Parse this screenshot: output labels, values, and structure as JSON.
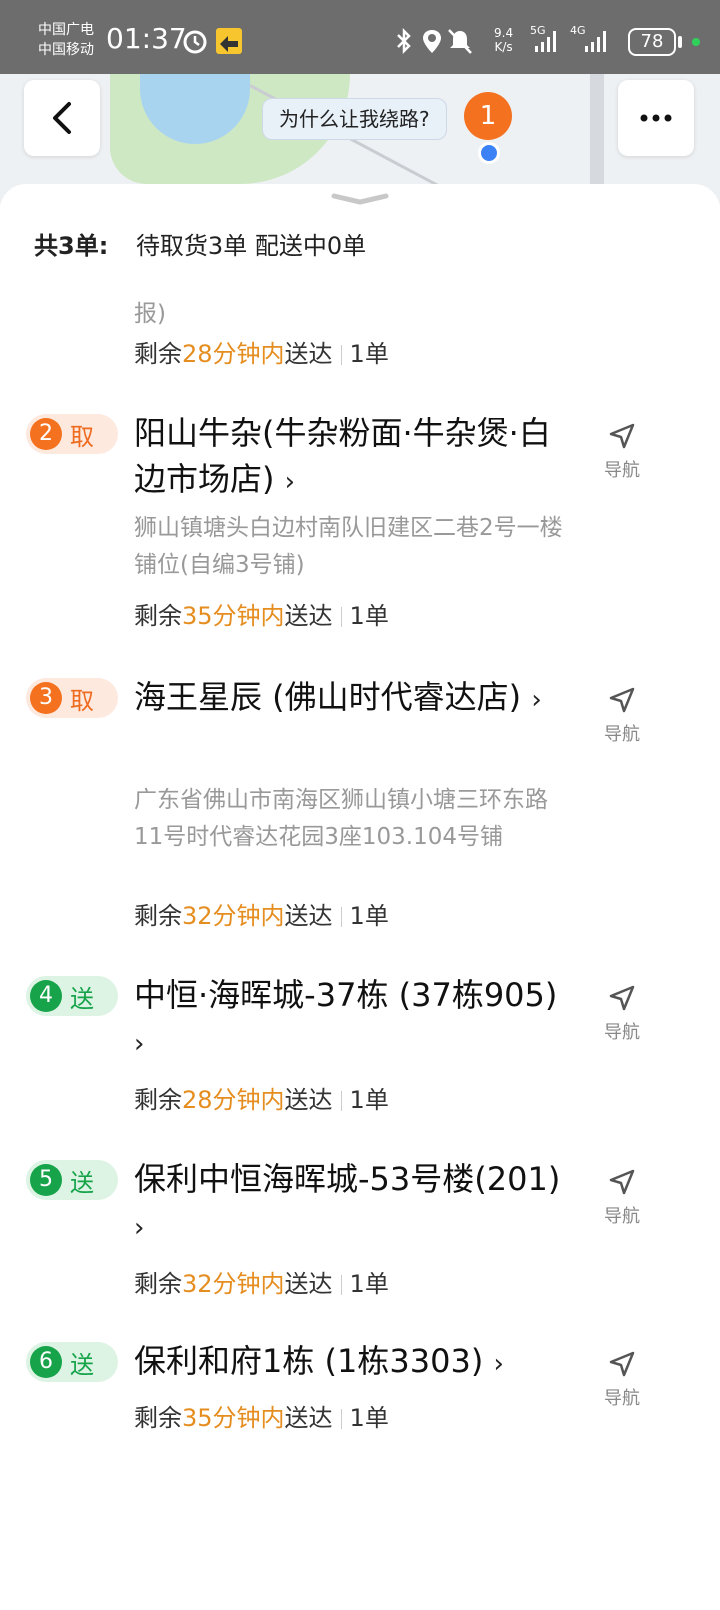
{
  "status_bar": {
    "carrier1": "中国广电",
    "carrier2": "中国移动",
    "time": "01:37",
    "speed_value": "9.4",
    "speed_unit": "K/s",
    "net1": "5G",
    "net2": "4G",
    "battery": "78"
  },
  "map": {
    "why_detour": "为什么让我绕路?",
    "rider_number": "1"
  },
  "summary": {
    "total": "共3单:",
    "pending_pickup": "待取货3单",
    "delivering": "配送中0单"
  },
  "partial_item": {
    "addr_tail": "报)",
    "remain": "剩余",
    "time": "28分钟内",
    "suffix": "送达",
    "count": "1单"
  },
  "nav_label": "导航",
  "orders": [
    {
      "num": "2",
      "kind": "取",
      "name": "阳山牛杂(牛杂粉面·牛杂煲·白边市场店)",
      "addr": "狮山镇塘头白边村南队旧建区二巷2号一楼铺位(自编3号铺)",
      "remain": "剩余",
      "time": "35分钟内",
      "suffix": "送达",
      "count": "1单"
    },
    {
      "num": "3",
      "kind": "取",
      "name": "海王星辰 (佛山时代睿达店)",
      "addr": "广东省佛山市南海区狮山镇小塘三环东路11号时代睿达花园3座103.104号铺",
      "remain": "剩余",
      "time": "32分钟内",
      "suffix": "送达",
      "count": "1单"
    },
    {
      "num": "4",
      "kind": "送",
      "name": "中恒·海晖城-37栋 (37栋905)",
      "remain": "剩余",
      "time": "28分钟内",
      "suffix": "送达",
      "count": "1单"
    },
    {
      "num": "5",
      "kind": "送",
      "name": "保利中恒海晖城-53号楼(201)",
      "remain": "剩余",
      "time": "32分钟内",
      "suffix": "送达",
      "count": "1单"
    },
    {
      "num": "6",
      "kind": "送",
      "name": "保利和府1栋 (1栋3303)",
      "remain": "剩余",
      "time": "35分钟内",
      "suffix": "送达",
      "count": "1单"
    }
  ]
}
